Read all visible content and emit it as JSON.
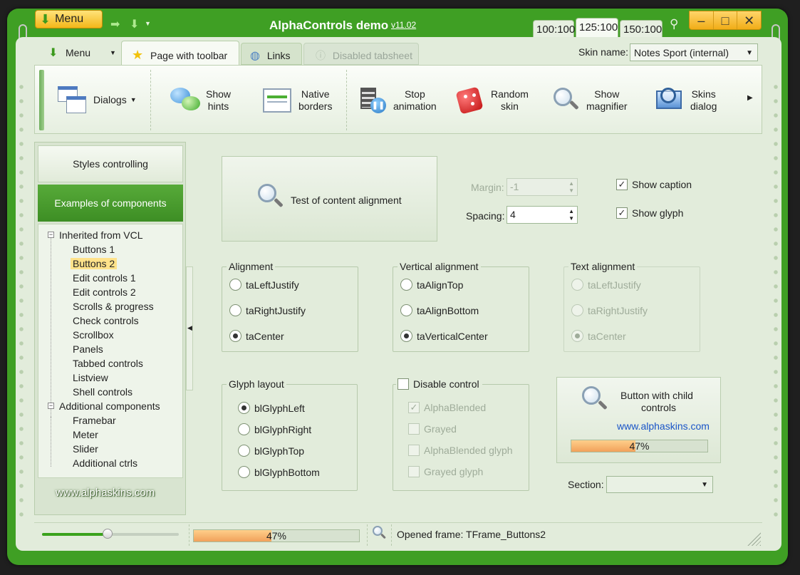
{
  "window": {
    "menu_label": "Menu",
    "title": "AlphaControls demo",
    "version": "v11.02",
    "zoom_tabs": [
      "100:100",
      "125:100",
      "150:100"
    ],
    "controls": {
      "minimize": "–",
      "maximize": "□",
      "close": "✕"
    }
  },
  "tabs": {
    "menu_label": "Menu",
    "page_label": "Page with toolbar",
    "links_label": "Links",
    "disabled_label": "Disabled tabsheet"
  },
  "skin": {
    "label": "Skin name:",
    "value": "Notes Sport (internal)"
  },
  "toolbar": {
    "dialogs": "Dialogs",
    "show_hints": [
      "Show",
      "hints"
    ],
    "native_borders": [
      "Native",
      "borders"
    ],
    "stop_animation": [
      "Stop",
      "animation"
    ],
    "random_skin": [
      "Random",
      "skin"
    ],
    "show_magnifier": [
      "Show",
      "magnifier"
    ],
    "skins_dialog": [
      "Skins",
      "dialog"
    ]
  },
  "left": {
    "styles_button": "Styles controlling",
    "examples_button": "Examples of components",
    "tree": {
      "root1": "Inherited from VCL",
      "children1": [
        "Buttons 1",
        "Buttons 2",
        "Edit controls 1",
        "Edit controls 2",
        "Scrolls & progress",
        "Check controls",
        "Scrollbox",
        "Panels",
        "Tabbed controls",
        "Listview",
        "Shell controls"
      ],
      "root2": "Additional components",
      "children2": [
        "Framebar",
        "Meter",
        "Slider",
        "Additional ctrls"
      ],
      "selected": "Buttons 2"
    },
    "site": "www.alphaskins.com"
  },
  "main": {
    "test_button": "Test of content alignment",
    "margin_label": "Margin:",
    "margin_value": "-1",
    "spacing_label": "Spacing:",
    "spacing_value": "4",
    "show_caption": "Show caption",
    "show_glyph": "Show glyph",
    "alignment": {
      "title": "Alignment",
      "options": [
        "taLeftJustify",
        "taRightJustify",
        "taCenter"
      ],
      "selected": "taCenter"
    },
    "vertical_alignment": {
      "title": "Vertical alignment",
      "options": [
        "taAlignTop",
        "taAlignBottom",
        "taVerticalCenter"
      ],
      "selected": "taVerticalCenter"
    },
    "text_alignment": {
      "title": "Text alignment",
      "options": [
        "taLeftJustify",
        "taRightJustify",
        "taCenter"
      ],
      "selected": "taCenter"
    },
    "glyph_layout": {
      "title": "Glyph layout",
      "options": [
        "blGlyphLeft",
        "blGlyphRight",
        "blGlyphTop",
        "blGlyphBottom"
      ],
      "selected": "blGlyphLeft"
    },
    "disable_control": {
      "title": "Disable control",
      "options": [
        "AlphaBlended",
        "Grayed",
        "AlphaBlended glyph",
        "Grayed glyph"
      ],
      "checked": [
        "AlphaBlended"
      ]
    },
    "child_button": {
      "line1": "Button with child",
      "line2": "controls",
      "link": "www.alphaskins.com",
      "progress_text": "47%",
      "progress": 0.47
    },
    "section_label": "Section:",
    "section_value": ""
  },
  "status": {
    "slider_value": 0.48,
    "progress_text": "47%",
    "progress": 0.47,
    "text": "Opened frame: TFrame_Buttons2"
  },
  "colors": {
    "frame": "#3f9f24",
    "accent": "#4a9f2f",
    "link": "#1a55c8"
  }
}
